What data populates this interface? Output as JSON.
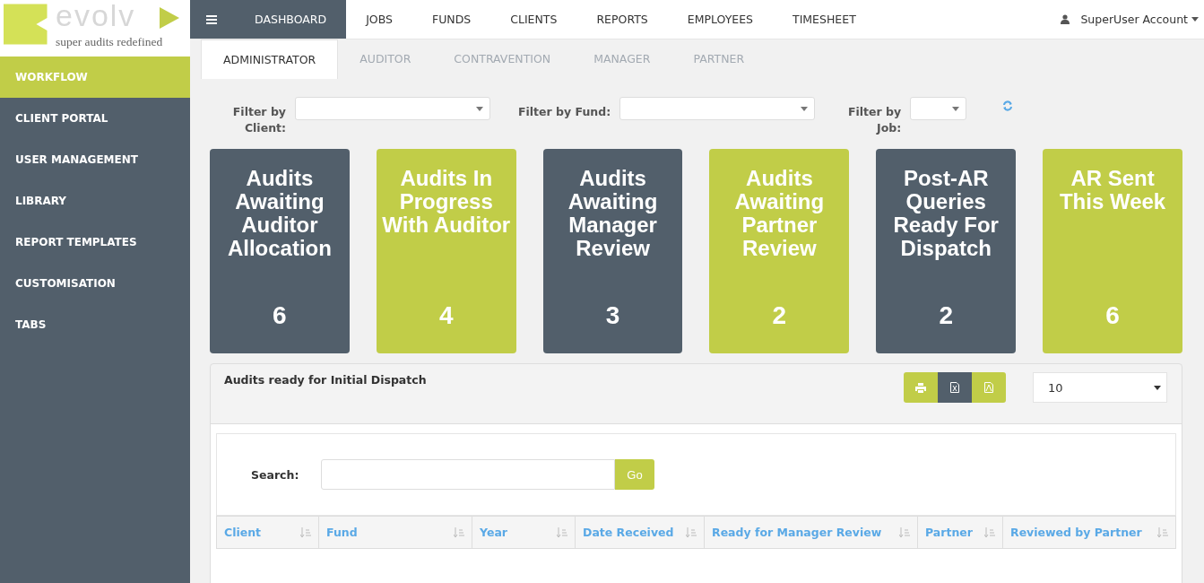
{
  "logo": {
    "word": "evolv",
    "tagline": "super audits redefined"
  },
  "sidebar": {
    "items": [
      {
        "label": "WORKFLOW",
        "selected": true
      },
      {
        "label": "CLIENT PORTAL",
        "selected": false
      },
      {
        "label": "USER MANAGEMENT",
        "selected": false
      },
      {
        "label": "LIBRARY",
        "selected": false
      },
      {
        "label": "REPORT TEMPLATES",
        "selected": false
      },
      {
        "label": "CUSTOMISATION",
        "selected": false
      },
      {
        "label": "TABS",
        "selected": false
      }
    ]
  },
  "top_nav": {
    "items": [
      {
        "label": "DASHBOARD",
        "selected": true
      },
      {
        "label": "JOBS",
        "selected": false
      },
      {
        "label": "FUNDS",
        "selected": false
      },
      {
        "label": "CLIENTS",
        "selected": false
      },
      {
        "label": "REPORTS",
        "selected": false
      },
      {
        "label": "EMPLOYEES",
        "selected": false
      },
      {
        "label": "TIMESHEET",
        "selected": false
      }
    ],
    "account": "SuperUser Account"
  },
  "tabs": [
    {
      "label": "ADMINISTRATOR",
      "selected": true
    },
    {
      "label": "AUDITOR",
      "selected": false
    },
    {
      "label": "CONTRAVENTION",
      "selected": false
    },
    {
      "label": "MANAGER",
      "selected": false
    },
    {
      "label": "PARTNER",
      "selected": false
    }
  ],
  "filters": [
    {
      "label": "Filter by Client:"
    },
    {
      "label": "Filter by Fund:"
    },
    {
      "label": "Filter by Job:"
    }
  ],
  "cards": [
    {
      "title": "Audits Awaiting Auditor Allocation",
      "count": "6",
      "color": "#525f6b"
    },
    {
      "title": "Audits In Progress With Auditor",
      "count": "4",
      "color": "#c1cd48"
    },
    {
      "title": "Audits Awaiting Manager Review",
      "count": "3",
      "color": "#525f6b"
    },
    {
      "title": "Audits Awaiting Partner Review",
      "count": "2",
      "color": "#c1cd48"
    },
    {
      "title": "Post-AR Queries Ready For Dispatch",
      "count": "2",
      "color": "#525f6b"
    },
    {
      "title": "AR Sent This Week",
      "count": "6",
      "color": "#c1cd48"
    }
  ],
  "table_panel": {
    "title": "Audits ready for Initial Dispatch",
    "page_size": "10",
    "search_label": "Search:",
    "go": "Go",
    "columns": [
      "Client",
      "Fund",
      "Year",
      "Date Received",
      "Ready for Manager Review",
      "Partner",
      "Reviewed by Partner"
    ]
  }
}
